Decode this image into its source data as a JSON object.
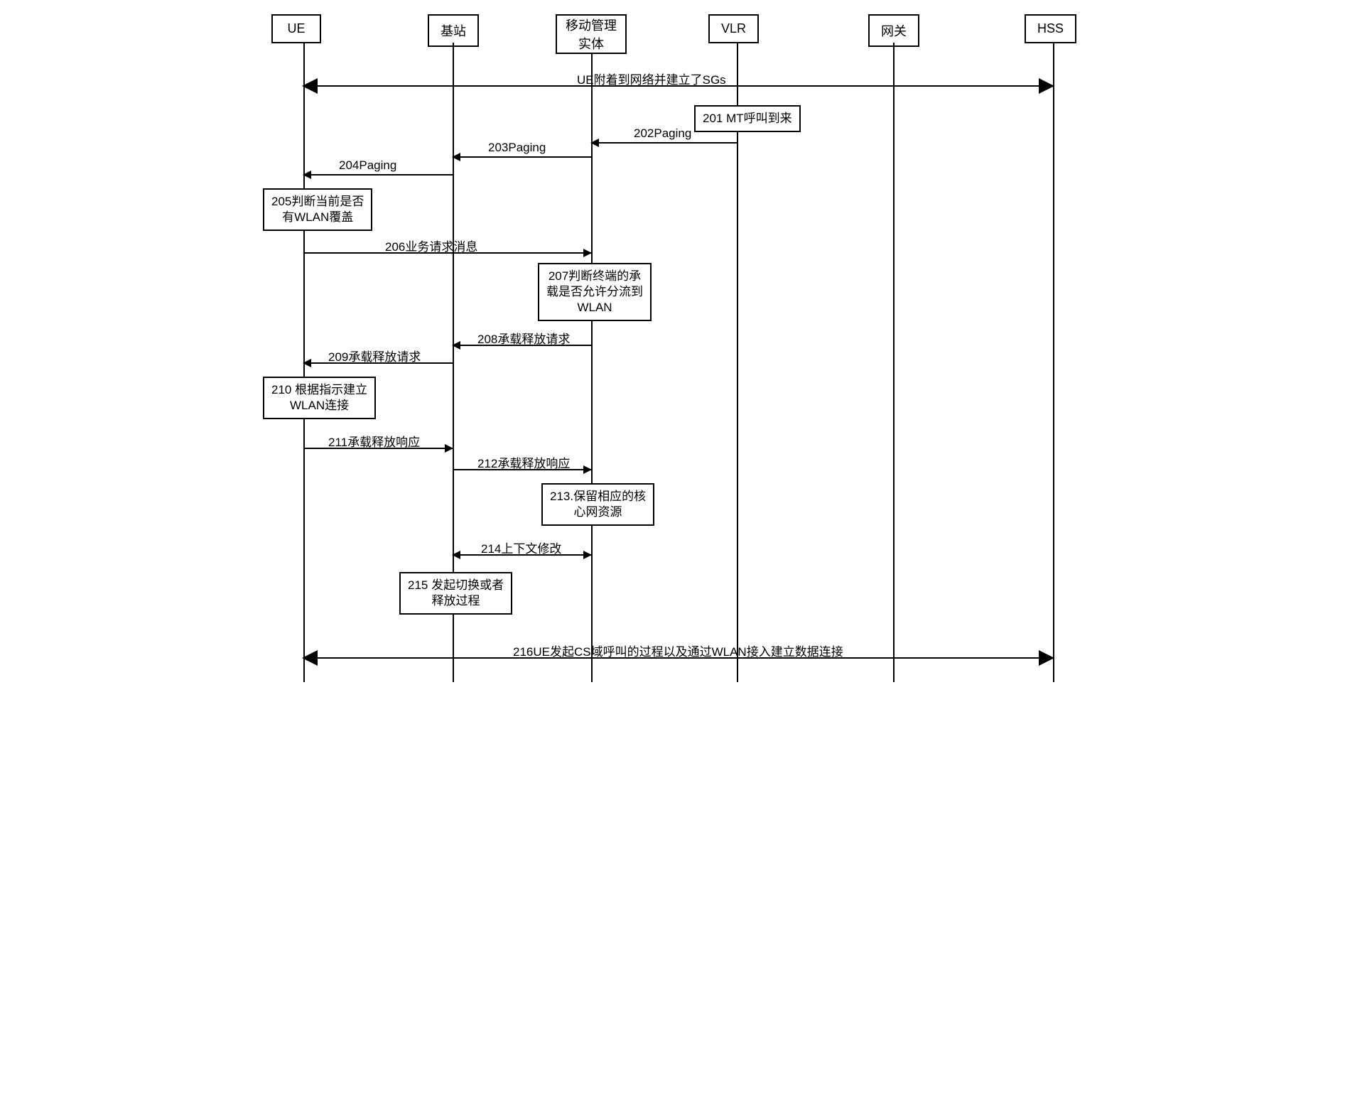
{
  "participants": {
    "ue": "UE",
    "bs": "基站",
    "mme_line1": "移动管理",
    "mme_line2": "实体",
    "vlr": "VLR",
    "gw": "网关",
    "hss": "HSS"
  },
  "steps": {
    "s0_attach": "UE附着到网络并建立了SGs",
    "s201": "201 MT呼叫到来",
    "s202": "202Paging",
    "s203": "203Paging",
    "s204": "204Paging",
    "s205_line1": "205判断当前是否",
    "s205_line2": "有WLAN覆盖",
    "s206": "206业务请求消息",
    "s207_line1": "207判断终端的承",
    "s207_line2": "载是否允许分流到",
    "s207_line3": "WLAN",
    "s208": "208承载释放请求",
    "s209": "209承载释放请求",
    "s210_line1": "210 根据指示建立",
    "s210_line2": "WLAN连接",
    "s211": "211承载释放响应",
    "s212": "212承载释放响应",
    "s213_line1": "213.保留相应的核",
    "s213_line2": "心网资源",
    "s214": "214上下文修改",
    "s215_line1": "215 发起切换或者",
    "s215_line2": "释放过程",
    "s216": "216UE发起CS域呼叫的过程以及通过WLAN接入建立数据连接"
  }
}
